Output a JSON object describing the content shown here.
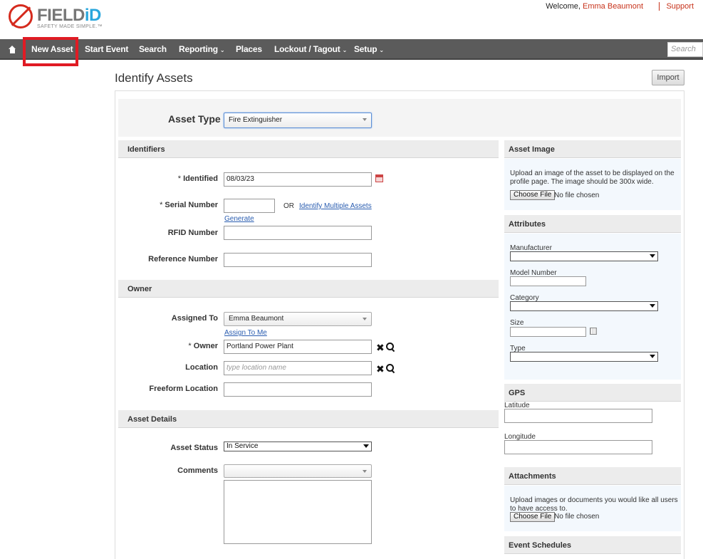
{
  "brand": {
    "name_part1": "FIELD",
    "name_part2": "iD",
    "tagline": "SAFETY MADE SIMPLE.™"
  },
  "header": {
    "welcome_prefix": "Welcome,",
    "user_name": "Emma Beaumont",
    "support_link": "Support"
  },
  "nav": {
    "items": [
      {
        "label": "New Asset"
      },
      {
        "label": "Start Event"
      },
      {
        "label": "Search"
      },
      {
        "label": "Reporting"
      },
      {
        "label": "Places"
      },
      {
        "label": "Lockout / Tagout"
      },
      {
        "label": "Setup"
      }
    ],
    "search_placeholder": "Search"
  },
  "page": {
    "title": "Identify Assets",
    "import_label": "Import"
  },
  "asset_type": {
    "label": "Asset Type",
    "value": "Fire Extinguisher"
  },
  "identifiers": {
    "heading": "Identifiers",
    "identified_label": "Identified",
    "identified_value": "08/03/23",
    "serial_label": "Serial Number",
    "serial_value": "",
    "or_text": "OR",
    "multi_link": "Identify Multiple Assets",
    "generate_link": "Generate",
    "rfid_label": "RFID Number",
    "reference_label": "Reference Number"
  },
  "owner": {
    "heading": "Owner",
    "assigned_label": "Assigned To",
    "assigned_value": "Emma Beaumont",
    "assign_me_link": "Assign To Me",
    "owner_label": "Owner",
    "owner_value": "Portland Power Plant",
    "location_label": "Location",
    "location_placeholder": "type location name",
    "freeform_label": "Freeform Location"
  },
  "details": {
    "heading": "Asset Details",
    "status_label": "Asset Status",
    "status_value": "In Service",
    "comments_label": "Comments"
  },
  "asset_image": {
    "heading": "Asset Image",
    "description": "Upload an image of the asset to be displayed on the profile page. The image should be 300x wide.",
    "choose_label": "Choose File",
    "no_file": "No file chosen"
  },
  "attributes": {
    "heading": "Attributes",
    "manufacturer_label": "Manufacturer",
    "model_label": "Model Number",
    "category_label": "Category",
    "size_label": "Size",
    "type_label": "Type"
  },
  "gps": {
    "heading": "GPS",
    "latitude_label": "Latitude",
    "longitude_label": "Longitude"
  },
  "attachments": {
    "heading": "Attachments",
    "description": "Upload images or documents you would like all users to have access to.",
    "choose_label": "Choose File",
    "no_file": "No file chosen"
  },
  "event_schedules": {
    "heading": "Event Schedules"
  },
  "colors": {
    "accent": "#c7321a",
    "nav_bg": "#5b5b5b",
    "highlight": "#e01b24"
  }
}
